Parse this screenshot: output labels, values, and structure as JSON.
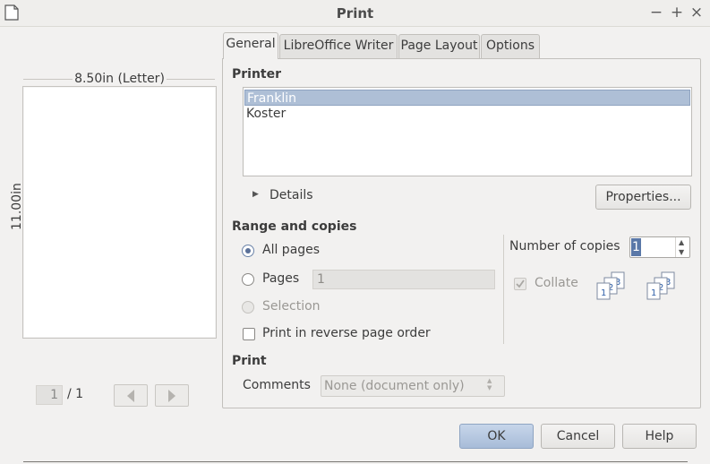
{
  "window": {
    "title": "Print"
  },
  "preview": {
    "paper_width": "8.50in (Letter)",
    "paper_height": "11.00in",
    "current_page": "1",
    "page_total": "/ 1"
  },
  "tabs": [
    {
      "label": "General"
    },
    {
      "label": "LibreOffice Writer"
    },
    {
      "label": "Page Layout"
    },
    {
      "label": "Options"
    }
  ],
  "printer": {
    "section_title": "Printer",
    "printers": [
      "Franklin",
      "Koster"
    ],
    "selected": "Franklin",
    "details_label": "Details",
    "properties_label": "Properties..."
  },
  "range": {
    "section_title": "Range and copies",
    "all_pages_label": "All pages",
    "pages_label": "Pages",
    "pages_value": "1",
    "selection_label": "Selection",
    "reverse_label": "Print in reverse page order",
    "copies_label": "Number of copies",
    "copies_value": "1",
    "collate_label": "Collate"
  },
  "print_section": {
    "section_title": "Print",
    "comments_label": "Comments",
    "comments_value": "None (document only)"
  },
  "buttons": {
    "ok": "OK",
    "cancel": "Cancel",
    "help": "Help"
  }
}
